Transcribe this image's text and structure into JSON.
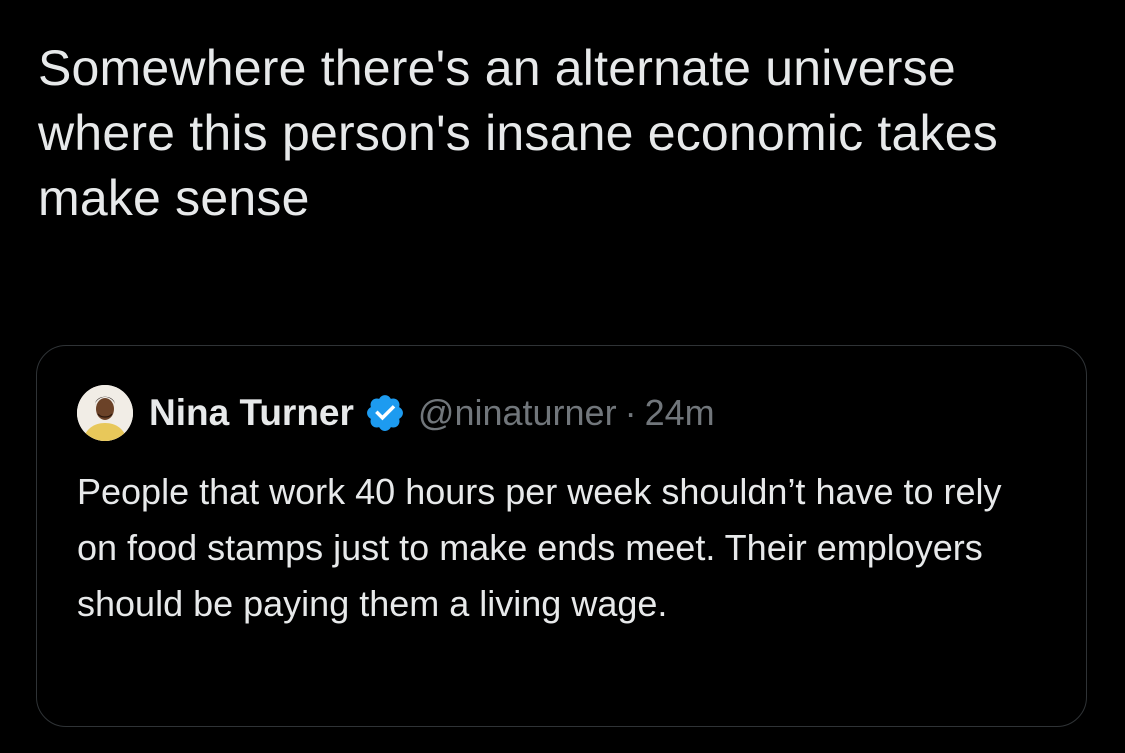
{
  "tweet": {
    "text": "Somewhere there's an alternate universe where this person's insane economic takes make sense"
  },
  "quoted_tweet": {
    "display_name": "Nina Turner",
    "verified": true,
    "handle": "@ninaturner",
    "separator": "·",
    "time": "24m",
    "text": "People that work 40 hours per week shouldn’t have to rely on food stamps just to make ends meet. Their employers should be paying them a living wage."
  },
  "icons": {
    "verified": "verified-badge-icon",
    "avatar": "profile-avatar"
  },
  "colors": {
    "background": "#000000",
    "primary_text": "#e7e9ea",
    "secondary_text": "#71767b",
    "border": "#2f3336",
    "verified_blue": "#1d9bf0"
  }
}
